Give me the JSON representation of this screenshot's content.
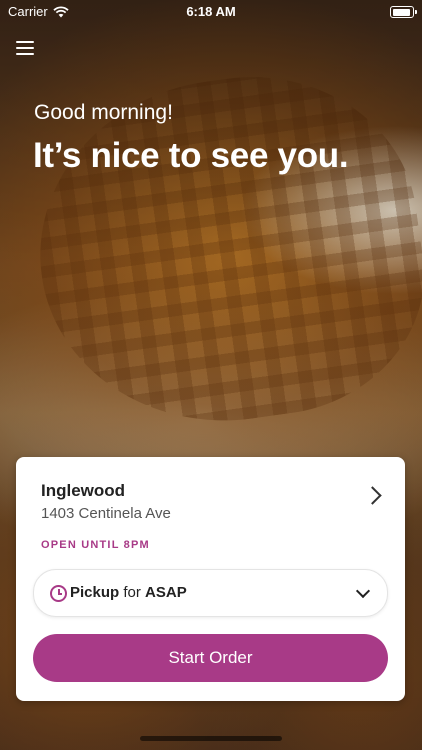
{
  "status_bar": {
    "carrier": "Carrier",
    "time": "6:18 AM"
  },
  "hero": {
    "greeting": "Good morning!",
    "headline": "It’s nice to see you."
  },
  "location": {
    "name": "Inglewood",
    "address": "1403 Centinela Ave",
    "hours": "OPEN UNTIL 8PM"
  },
  "order_mode": {
    "method": "Pickup",
    "connector": "for",
    "timing": "ASAP"
  },
  "actions": {
    "start_order": "Start Order"
  },
  "colors": {
    "accent": "#a83a87",
    "card": "#ffffff",
    "text": "#222222"
  },
  "icons": [
    "wifi-icon",
    "battery-icon",
    "hamburger-menu-icon",
    "chevron-right-icon",
    "clock-icon",
    "chevron-down-icon"
  ]
}
